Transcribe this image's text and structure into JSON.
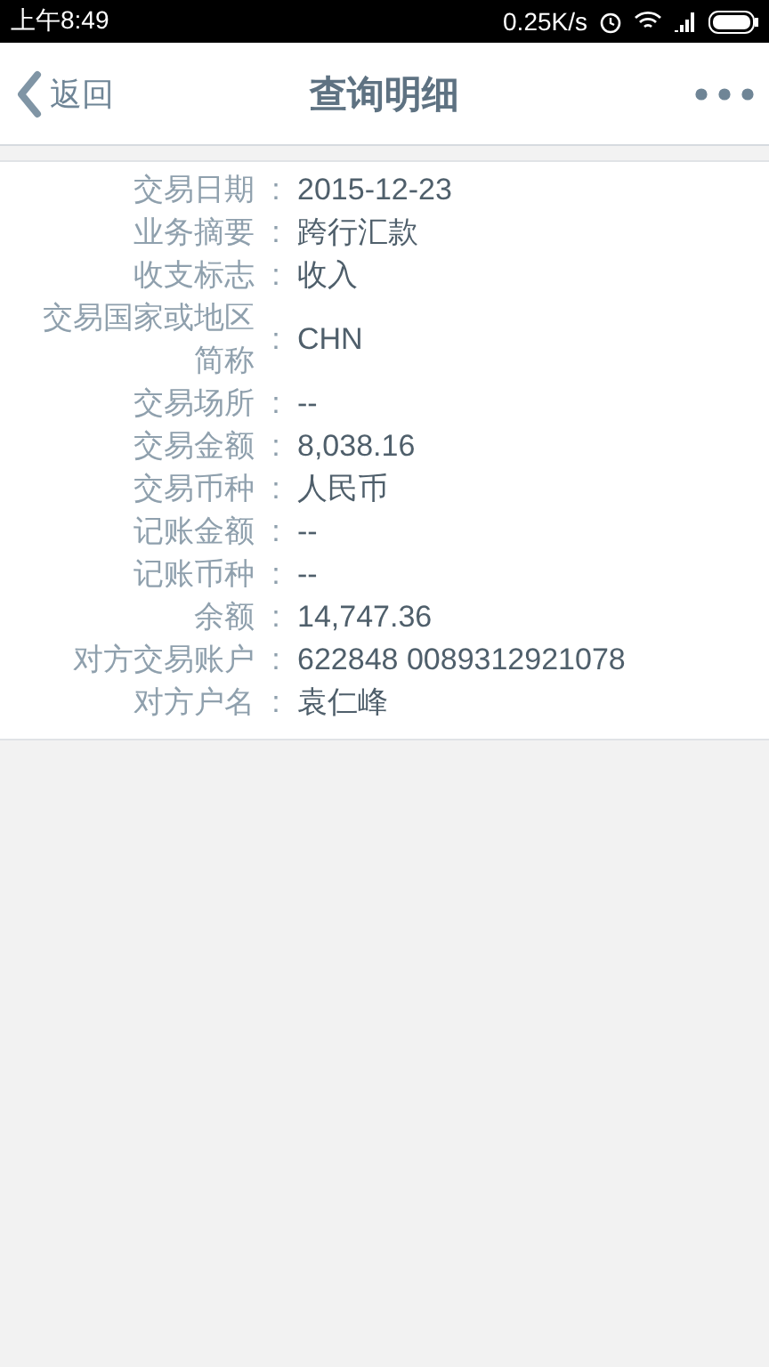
{
  "status_bar": {
    "time": "上午8:49",
    "speed": "0.25K/s"
  },
  "header": {
    "back": "返回",
    "title": "查询明细"
  },
  "rows": [
    {
      "label": "交易日期",
      "separator": ":",
      "value": "2015-12-23"
    },
    {
      "label": "业务摘要",
      "separator": ":",
      "value": "跨行汇款"
    },
    {
      "label": "收支标志",
      "separator": ":",
      "value": "收入"
    },
    {
      "label": "交易国家或地区简称",
      "separator": ":",
      "value": "CHN"
    },
    {
      "label": "交易场所",
      "separator": ":",
      "value": "--"
    },
    {
      "label": "交易金额",
      "separator": ":",
      "value": "8,038.16"
    },
    {
      "label": "交易币种",
      "separator": ":",
      "value": "人民币"
    },
    {
      "label": "记账金额",
      "separator": ":",
      "value": "--"
    },
    {
      "label": "记账币种",
      "separator": ":",
      "value": "--"
    },
    {
      "label": "余额",
      "separator": ":",
      "value": "14,747.36"
    },
    {
      "label": "对方交易账户",
      "separator": ":",
      "value": "622848 0089312921078"
    },
    {
      "label": "对方户名",
      "separator": ":",
      "value": "袁仁峰"
    }
  ]
}
